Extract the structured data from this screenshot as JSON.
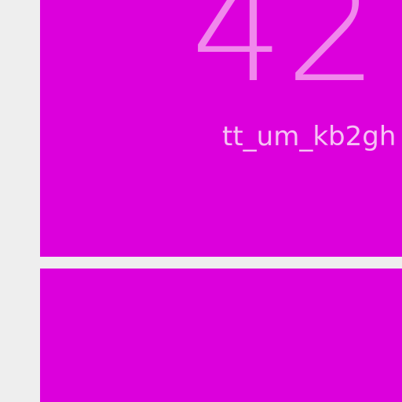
{
  "tiles": [
    {
      "value": "42",
      "label": "tt_um_kb2gh"
    },
    {
      "value": "",
      "label": ""
    }
  ],
  "colors": {
    "background": "#eeeeee",
    "tile": "#dc00dc",
    "number": "#f088ec",
    "label": "#f6c2f4"
  }
}
